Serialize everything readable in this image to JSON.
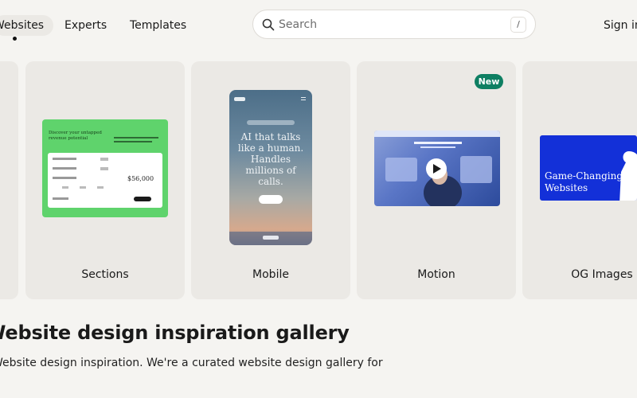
{
  "header": {
    "tabs": [
      {
        "label": "Websites",
        "active": true
      },
      {
        "label": "Experts",
        "active": false
      },
      {
        "label": "Templates",
        "active": false
      }
    ],
    "search": {
      "placeholder": "Search",
      "shortcut": "/"
    },
    "sign_in": "Sign in"
  },
  "categories": [
    {
      "label": "Sections"
    },
    {
      "label": "Mobile"
    },
    {
      "label": "Motion",
      "badge": "New"
    },
    {
      "label": "OG Images"
    }
  ],
  "previews": {
    "sections": {
      "headline": "Discover your untapped revenue potential",
      "amount": "$56,000"
    },
    "mobile": {
      "headline": "AI that talks like a human. Handles millions of calls."
    },
    "og": {
      "headline_line1": "Game-Changing",
      "headline_line2": "Websites"
    }
  },
  "page": {
    "heading": "Website design inspiration gallery",
    "subtitle": "Website design inspiration. We're a curated website design gallery for"
  },
  "colors": {
    "background": "#f5f4f1",
    "card": "#ebe9e5",
    "badge": "#0e7f62",
    "og_blue": "#1330d8",
    "sections_green": "#5fd36c"
  },
  "icons": [
    "search-icon",
    "play-icon"
  ]
}
